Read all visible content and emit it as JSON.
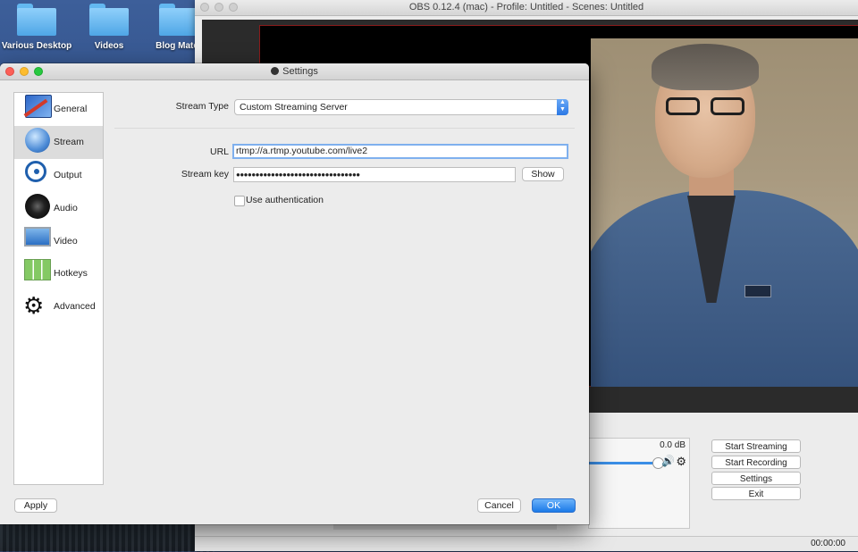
{
  "desktop": {
    "folders": [
      {
        "label": "Various Desktop"
      },
      {
        "label": "Videos"
      },
      {
        "label": "Blog Mater"
      }
    ]
  },
  "obs": {
    "title": "OBS 0.12.4 (mac) - Profile: Untitled - Scenes: Untitled",
    "mixer_level": "0.0 dB",
    "buttons": {
      "start_streaming": "Start Streaming",
      "start_recording": "Start Recording",
      "settings": "Settings",
      "exit": "Exit"
    },
    "status_time": "00:00:00"
  },
  "settings": {
    "title": "Settings",
    "sidebar": [
      {
        "label": "General",
        "icon": "general-icon"
      },
      {
        "label": "Stream",
        "icon": "stream-icon",
        "selected": true
      },
      {
        "label": "Output",
        "icon": "output-icon"
      },
      {
        "label": "Audio",
        "icon": "audio-icon"
      },
      {
        "label": "Video",
        "icon": "video-icon"
      },
      {
        "label": "Hotkeys",
        "icon": "hotkeys-icon"
      },
      {
        "label": "Advanced",
        "icon": "gears-icon"
      }
    ],
    "stream_type_label": "Stream Type",
    "stream_type_value": "Custom Streaming Server",
    "url_label": "URL",
    "url_value": "rtmp://a.rtmp.youtube.com/live2",
    "stream_key_label": "Stream key",
    "stream_key_value": "●●●●●●●●●●●●●●●●●●●●●●●●●●●●●●●●",
    "show_label": "Show",
    "use_auth_label": "Use authentication",
    "apply_label": "Apply",
    "cancel_label": "Cancel",
    "ok_label": "OK"
  }
}
